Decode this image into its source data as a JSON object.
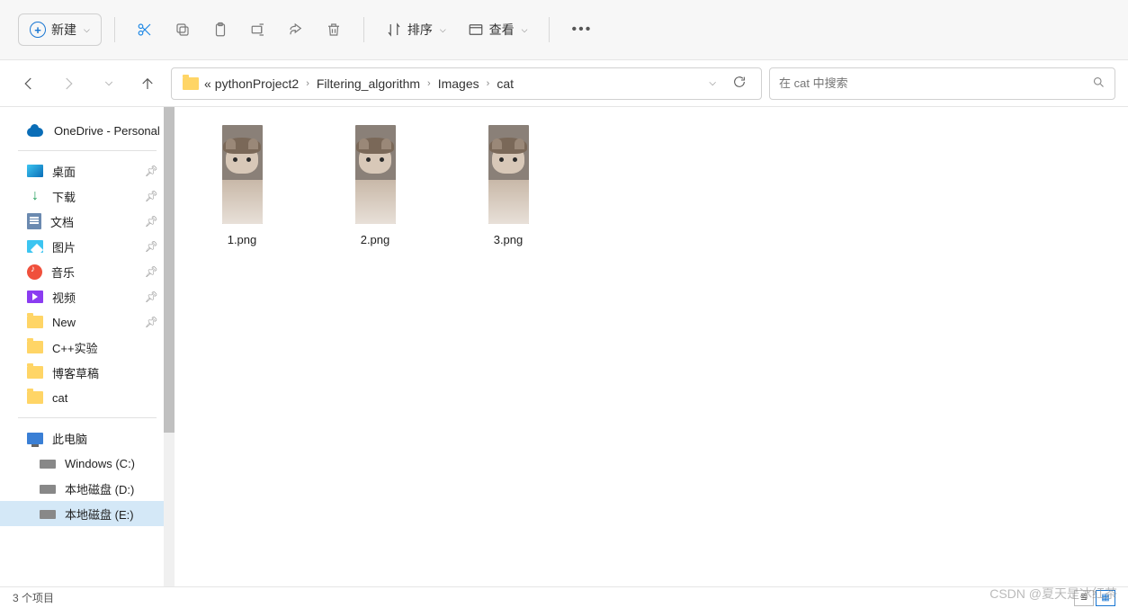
{
  "toolbar": {
    "new_label": "新建",
    "sort_label": "排序",
    "view_label": "查看"
  },
  "breadcrumb": {
    "prefix": "«",
    "items": [
      "pythonProject2",
      "Filtering_algorithm",
      "Images",
      "cat"
    ]
  },
  "search": {
    "placeholder": "在 cat 中搜索"
  },
  "sidebar": {
    "onedrive": "OneDrive - Personal",
    "quick": [
      {
        "label": "桌面",
        "icon": "desktop",
        "pinned": true
      },
      {
        "label": "下载",
        "icon": "download",
        "pinned": true
      },
      {
        "label": "文档",
        "icon": "doc",
        "pinned": true
      },
      {
        "label": "图片",
        "icon": "pic",
        "pinned": true
      },
      {
        "label": "音乐",
        "icon": "music",
        "pinned": true
      },
      {
        "label": "视频",
        "icon": "video",
        "pinned": true
      },
      {
        "label": "New",
        "icon": "folder",
        "pinned": true
      },
      {
        "label": "C++实验",
        "icon": "folder",
        "pinned": false
      },
      {
        "label": "博客草稿",
        "icon": "folder",
        "pinned": false
      },
      {
        "label": "cat",
        "icon": "folder",
        "pinned": false
      }
    ],
    "thispc": "此电脑",
    "drives": [
      {
        "label": "Windows (C:)",
        "active": false
      },
      {
        "label": "本地磁盘 (D:)",
        "active": false
      },
      {
        "label": "本地磁盘 (E:)",
        "active": true
      }
    ]
  },
  "files": [
    {
      "name": "1.png"
    },
    {
      "name": "2.png"
    },
    {
      "name": "3.png"
    }
  ],
  "status": {
    "count": "3 个项目"
  },
  "watermark": "CSDN @夏天是冰红茶"
}
